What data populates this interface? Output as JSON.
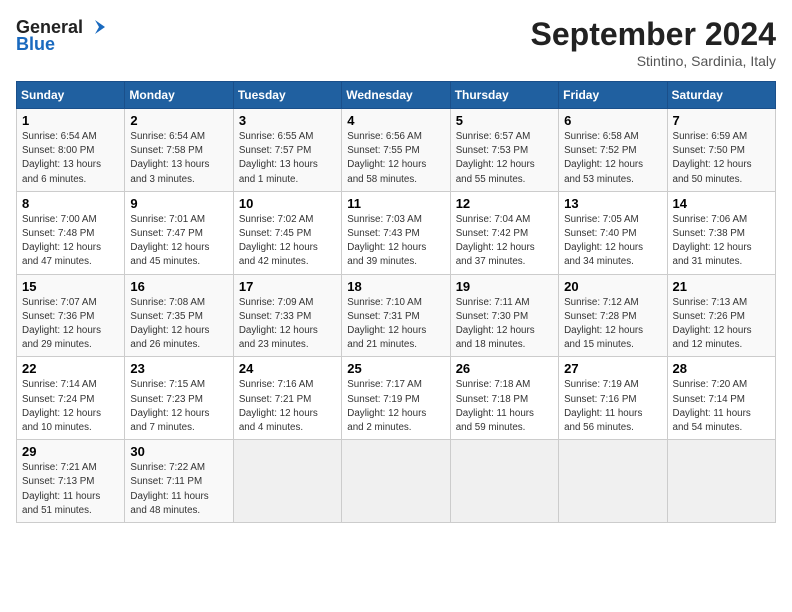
{
  "header": {
    "logo_line1": "General",
    "logo_line2": "Blue",
    "month": "September 2024",
    "location": "Stintino, Sardinia, Italy"
  },
  "columns": [
    "Sunday",
    "Monday",
    "Tuesday",
    "Wednesday",
    "Thursday",
    "Friday",
    "Saturday"
  ],
  "weeks": [
    [
      {
        "day": "1",
        "info": "Sunrise: 6:54 AM\nSunset: 8:00 PM\nDaylight: 13 hours\nand 6 minutes."
      },
      {
        "day": "2",
        "info": "Sunrise: 6:54 AM\nSunset: 7:58 PM\nDaylight: 13 hours\nand 3 minutes."
      },
      {
        "day": "3",
        "info": "Sunrise: 6:55 AM\nSunset: 7:57 PM\nDaylight: 13 hours\nand 1 minute."
      },
      {
        "day": "4",
        "info": "Sunrise: 6:56 AM\nSunset: 7:55 PM\nDaylight: 12 hours\nand 58 minutes."
      },
      {
        "day": "5",
        "info": "Sunrise: 6:57 AM\nSunset: 7:53 PM\nDaylight: 12 hours\nand 55 minutes."
      },
      {
        "day": "6",
        "info": "Sunrise: 6:58 AM\nSunset: 7:52 PM\nDaylight: 12 hours\nand 53 minutes."
      },
      {
        "day": "7",
        "info": "Sunrise: 6:59 AM\nSunset: 7:50 PM\nDaylight: 12 hours\nand 50 minutes."
      }
    ],
    [
      {
        "day": "8",
        "info": "Sunrise: 7:00 AM\nSunset: 7:48 PM\nDaylight: 12 hours\nand 47 minutes."
      },
      {
        "day": "9",
        "info": "Sunrise: 7:01 AM\nSunset: 7:47 PM\nDaylight: 12 hours\nand 45 minutes."
      },
      {
        "day": "10",
        "info": "Sunrise: 7:02 AM\nSunset: 7:45 PM\nDaylight: 12 hours\nand 42 minutes."
      },
      {
        "day": "11",
        "info": "Sunrise: 7:03 AM\nSunset: 7:43 PM\nDaylight: 12 hours\nand 39 minutes."
      },
      {
        "day": "12",
        "info": "Sunrise: 7:04 AM\nSunset: 7:42 PM\nDaylight: 12 hours\nand 37 minutes."
      },
      {
        "day": "13",
        "info": "Sunrise: 7:05 AM\nSunset: 7:40 PM\nDaylight: 12 hours\nand 34 minutes."
      },
      {
        "day": "14",
        "info": "Sunrise: 7:06 AM\nSunset: 7:38 PM\nDaylight: 12 hours\nand 31 minutes."
      }
    ],
    [
      {
        "day": "15",
        "info": "Sunrise: 7:07 AM\nSunset: 7:36 PM\nDaylight: 12 hours\nand 29 minutes."
      },
      {
        "day": "16",
        "info": "Sunrise: 7:08 AM\nSunset: 7:35 PM\nDaylight: 12 hours\nand 26 minutes."
      },
      {
        "day": "17",
        "info": "Sunrise: 7:09 AM\nSunset: 7:33 PM\nDaylight: 12 hours\nand 23 minutes."
      },
      {
        "day": "18",
        "info": "Sunrise: 7:10 AM\nSunset: 7:31 PM\nDaylight: 12 hours\nand 21 minutes."
      },
      {
        "day": "19",
        "info": "Sunrise: 7:11 AM\nSunset: 7:30 PM\nDaylight: 12 hours\nand 18 minutes."
      },
      {
        "day": "20",
        "info": "Sunrise: 7:12 AM\nSunset: 7:28 PM\nDaylight: 12 hours\nand 15 minutes."
      },
      {
        "day": "21",
        "info": "Sunrise: 7:13 AM\nSunset: 7:26 PM\nDaylight: 12 hours\nand 12 minutes."
      }
    ],
    [
      {
        "day": "22",
        "info": "Sunrise: 7:14 AM\nSunset: 7:24 PM\nDaylight: 12 hours\nand 10 minutes."
      },
      {
        "day": "23",
        "info": "Sunrise: 7:15 AM\nSunset: 7:23 PM\nDaylight: 12 hours\nand 7 minutes."
      },
      {
        "day": "24",
        "info": "Sunrise: 7:16 AM\nSunset: 7:21 PM\nDaylight: 12 hours\nand 4 minutes."
      },
      {
        "day": "25",
        "info": "Sunrise: 7:17 AM\nSunset: 7:19 PM\nDaylight: 12 hours\nand 2 minutes."
      },
      {
        "day": "26",
        "info": "Sunrise: 7:18 AM\nSunset: 7:18 PM\nDaylight: 11 hours\nand 59 minutes."
      },
      {
        "day": "27",
        "info": "Sunrise: 7:19 AM\nSunset: 7:16 PM\nDaylight: 11 hours\nand 56 minutes."
      },
      {
        "day": "28",
        "info": "Sunrise: 7:20 AM\nSunset: 7:14 PM\nDaylight: 11 hours\nand 54 minutes."
      }
    ],
    [
      {
        "day": "29",
        "info": "Sunrise: 7:21 AM\nSunset: 7:13 PM\nDaylight: 11 hours\nand 51 minutes."
      },
      {
        "day": "30",
        "info": "Sunrise: 7:22 AM\nSunset: 7:11 PM\nDaylight: 11 hours\nand 48 minutes."
      },
      {
        "day": "",
        "info": ""
      },
      {
        "day": "",
        "info": ""
      },
      {
        "day": "",
        "info": ""
      },
      {
        "day": "",
        "info": ""
      },
      {
        "day": "",
        "info": ""
      }
    ]
  ]
}
